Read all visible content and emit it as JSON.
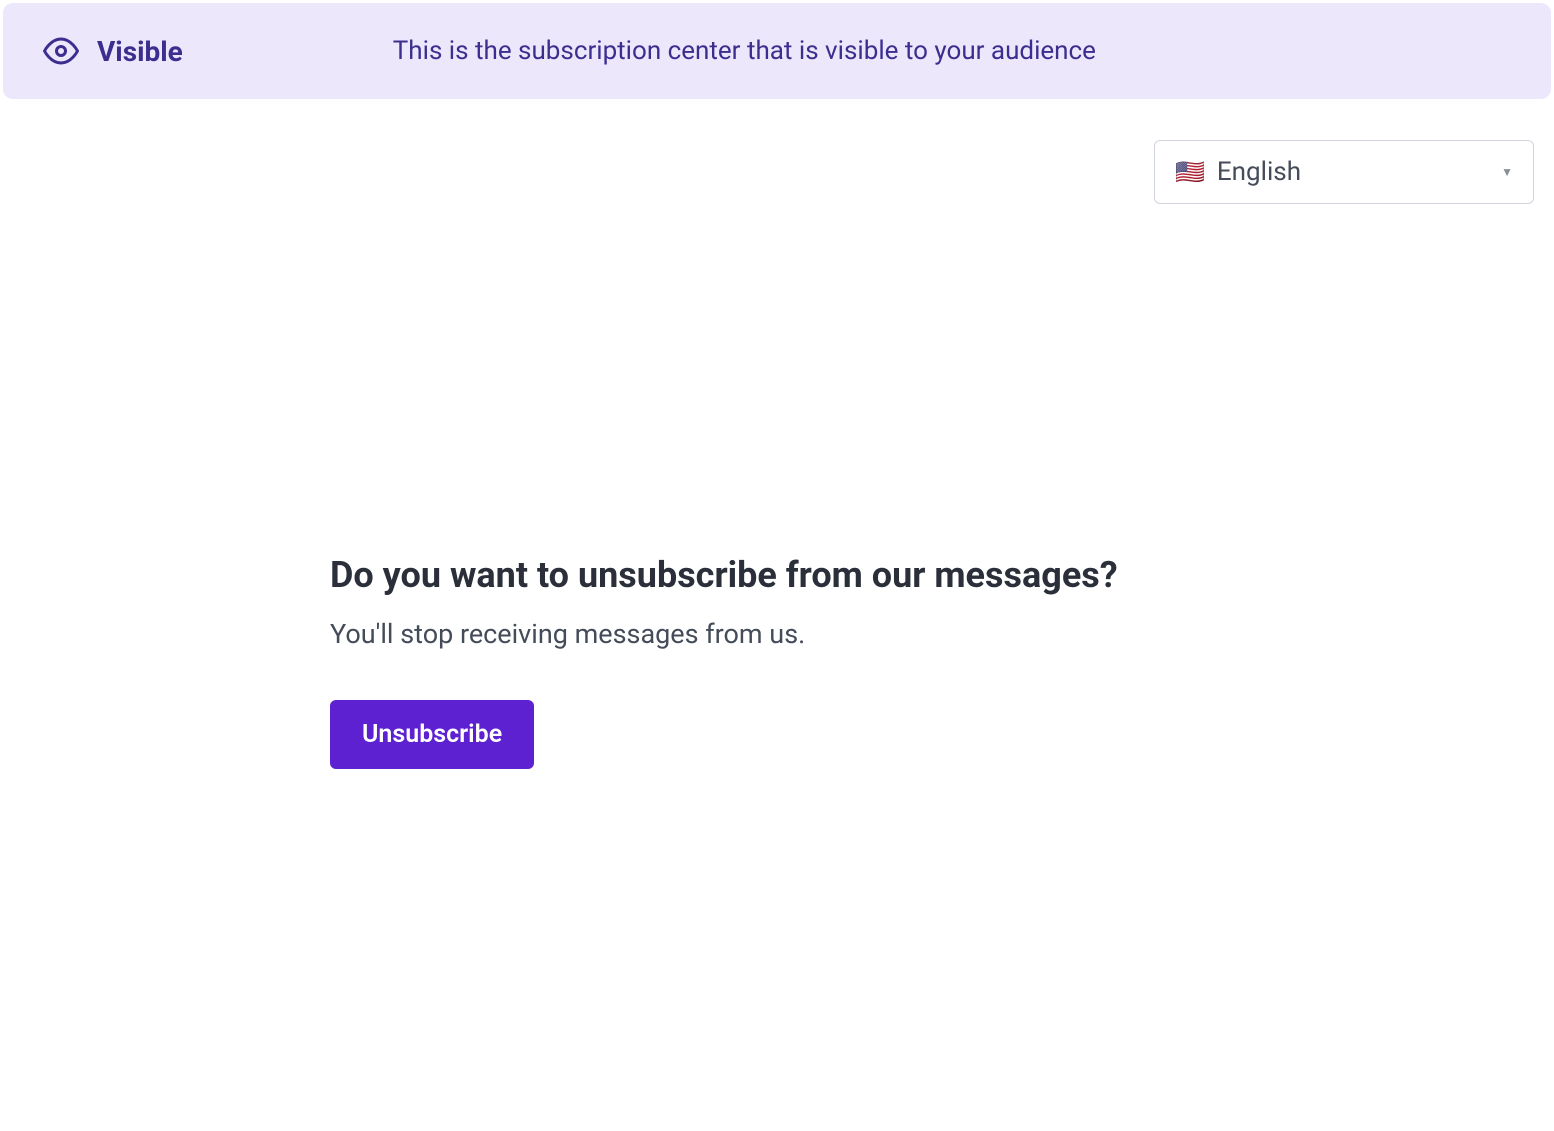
{
  "banner": {
    "label": "Visible",
    "message": "This is the subscription center that is visible to your audience"
  },
  "language_selector": {
    "flag": "🇺🇸",
    "selected": "English"
  },
  "main": {
    "heading": "Do you want to unsubscribe from our messages?",
    "subtext": "You'll stop receiving messages from us.",
    "button_label": "Unsubscribe"
  }
}
